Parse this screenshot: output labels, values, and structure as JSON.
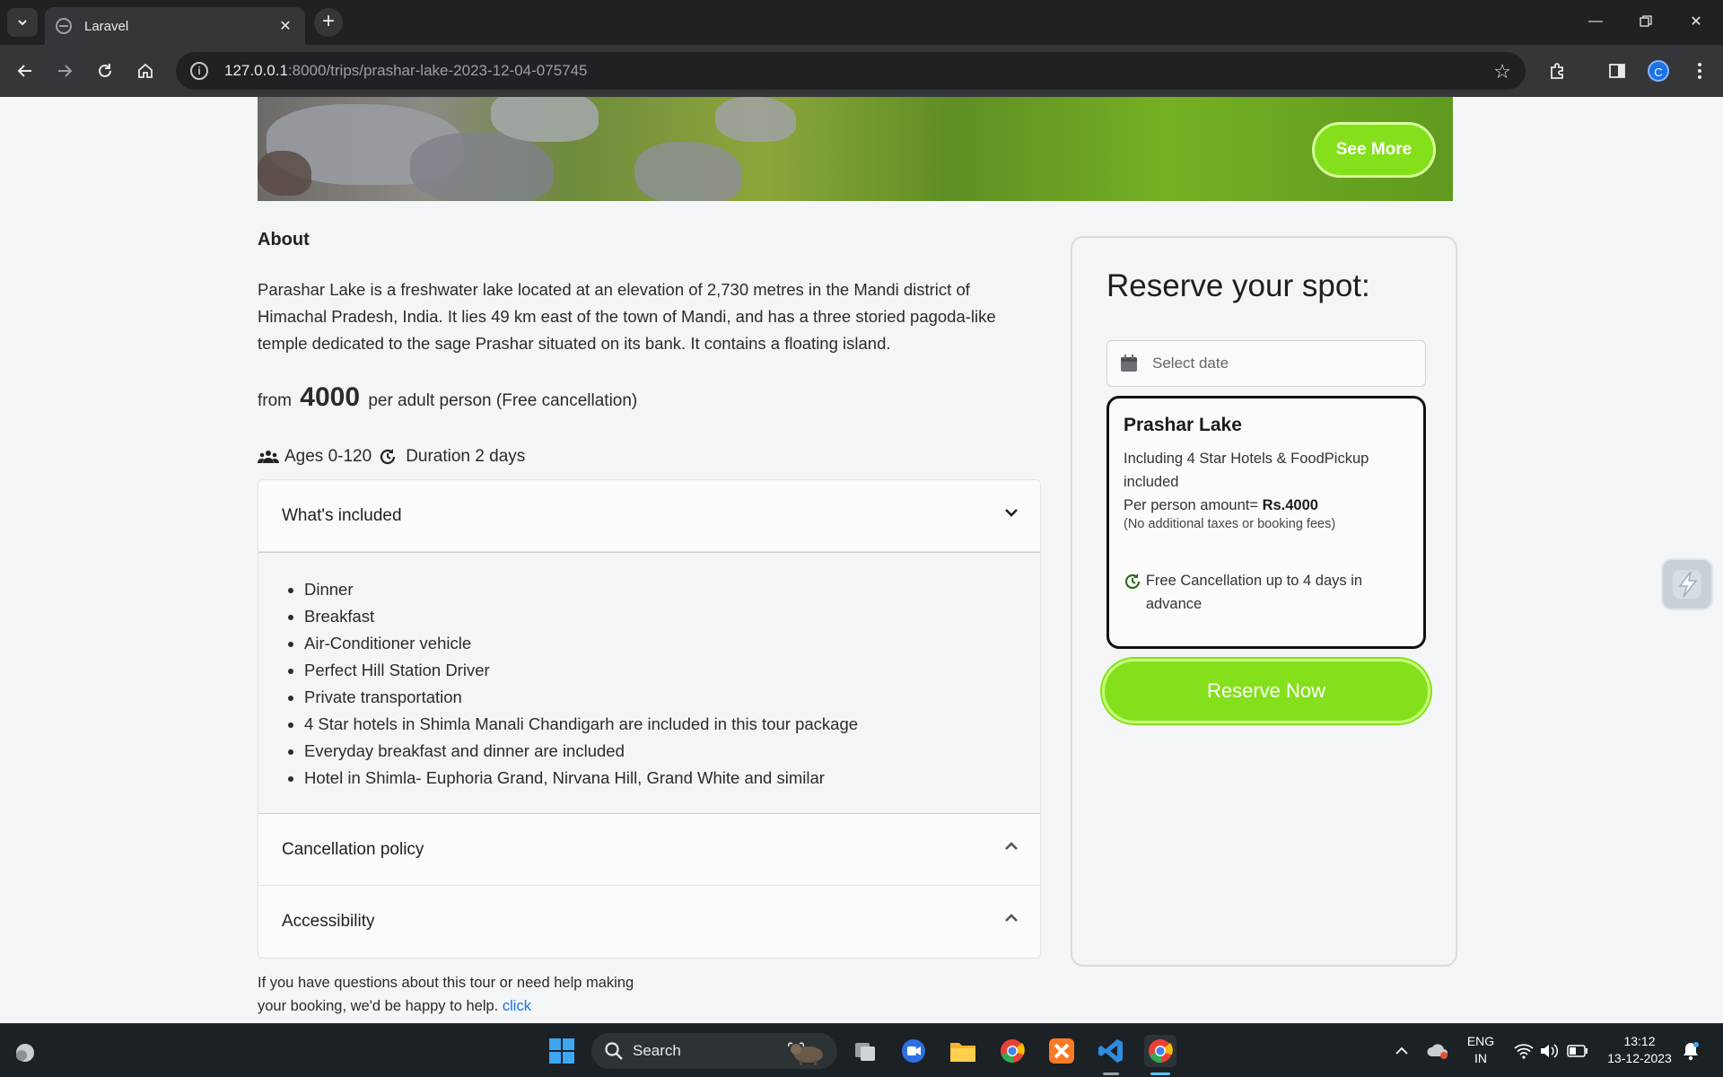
{
  "browser": {
    "tab_title": "Laravel",
    "url_host": "127.0.0.1",
    "url_rest": ":8000/trips/prashar-lake-2023-12-04-075745",
    "profile_initial": "C"
  },
  "hero": {
    "see_more_label": "See More"
  },
  "about": {
    "heading": "About",
    "description": "Parashar Lake is a freshwater lake located at an elevation of 2,730 metres in the Mandi district of Himachal Pradesh, India. It lies 49 km east of the town of Mandi, and has a three storied pagoda-like temple dedicated to the sage Prashar situated on its bank. It contains a floating island.",
    "price_prefix": "from",
    "price": "4000",
    "price_suffix": "per adult person (Free cancellation)",
    "ages": "Ages 0-120",
    "duration": "Duration 2 days"
  },
  "accordion": {
    "included_title": "What's included",
    "included_items": [
      "Dinner",
      "Breakfast",
      "Air-Conditioner vehicle",
      "Perfect Hill Station Driver",
      "Private transportation",
      "4 Star hotels in Shimla Manali Chandigarh are included in this tour package",
      "Everyday breakfast and dinner are included",
      "Hotel in Shimla- Euphoria Grand, Nirvana Hill, Grand White and similar"
    ],
    "cancellation_title": "Cancellation policy",
    "accessibility_title": "Accessibility"
  },
  "help": {
    "text": "If you have questions about this tour or need help making your booking, we'd be happy to help.",
    "link": "click"
  },
  "reserve": {
    "title": "Reserve your spot:",
    "date_placeholder": "Select date",
    "package_name": "Prashar Lake",
    "package_includes": "Including 4 Star Hotels & FoodPickup included",
    "amount_label": "Per person amount=",
    "amount_value": "Rs.4000",
    "fees_note": "(No additional taxes or booking fees)",
    "cancellation": "Free Cancellation up to 4 days in advance",
    "button_label": "Reserve Now"
  },
  "taskbar": {
    "search_label": "Search",
    "lang_top": "ENG",
    "lang_bottom": "IN",
    "time": "13:12",
    "date": "13-12-2023"
  },
  "colors": {
    "accent_green": "#84e01a",
    "chrome_dark": "#202124",
    "chrome_toolbar": "#35363a",
    "link_blue": "#1a73e8"
  }
}
